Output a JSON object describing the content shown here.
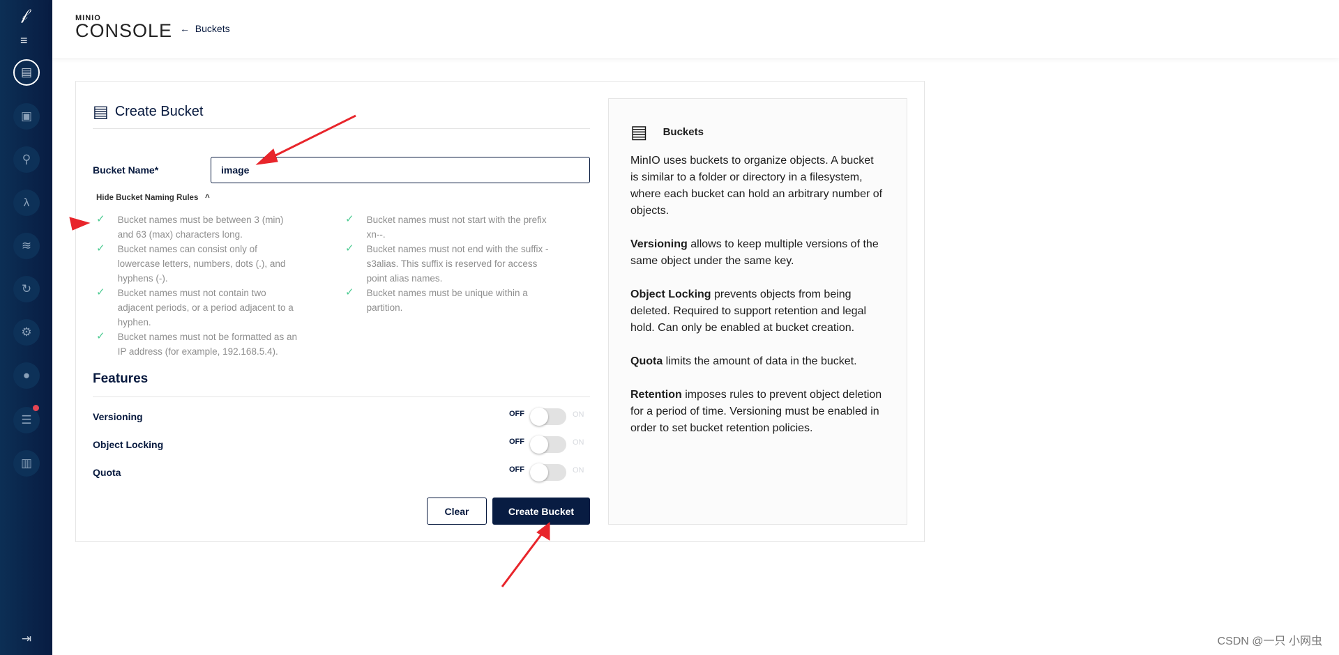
{
  "header": {
    "logo_top": "MINIO",
    "logo_bottom": "CONSOLE",
    "back_label": "Buckets"
  },
  "sidebar": {
    "icons": [
      "minio-bird-icon",
      "menu-icon",
      "buckets-icon",
      "identity-icon",
      "monitoring-icon",
      "lambda-icon",
      "tiers-icon",
      "replication-icon",
      "settings-icon",
      "health-icon",
      "license-icon",
      "documentation-icon",
      "logout-icon"
    ],
    "badge_color": "#e64553"
  },
  "form": {
    "title": "Create Bucket",
    "bucket_name_label": "Bucket Name*",
    "bucket_name_value": "image",
    "rules_toggle": "Hide Bucket Naming Rules",
    "rules_left": [
      "Bucket names must be between 3 (min) and 63 (max) characters long.",
      "Bucket names can consist only of lowercase letters, numbers, dots (.), and hyphens (-).",
      "Bucket names must not contain two adjacent periods, or a period adjacent to a hyphen.",
      "Bucket names must not be formatted as an IP address (for example, 192.168.5.4)."
    ],
    "rules_right": [
      "Bucket names must not start with the prefix xn--.",
      "Bucket names must not end with the suffix -s3alias. This suffix is reserved for access point alias names.",
      "Bucket names must be unique within a partition."
    ],
    "features_title": "Features",
    "features": [
      {
        "label": "Versioning",
        "off": "OFF",
        "on": "ON",
        "enabled": false
      },
      {
        "label": "Object Locking",
        "off": "OFF",
        "on": "ON",
        "enabled": false
      },
      {
        "label": "Quota",
        "off": "OFF",
        "on": "ON",
        "enabled": false
      }
    ],
    "clear_label": "Clear",
    "create_label": "Create Bucket"
  },
  "info": {
    "title": "Buckets",
    "paragraphs": [
      {
        "bold": "",
        "text": "MinIO uses buckets to organize objects. A bucket is similar to a folder or directory in a filesystem, where each bucket can hold an arbitrary number of objects."
      },
      {
        "bold": "Versioning",
        "text": " allows to keep multiple versions of the same object under the same key."
      },
      {
        "bold": "Object Locking",
        "text": " prevents objects from being deleted. Required to support retention and legal hold. Can only be enabled at bucket creation."
      },
      {
        "bold": "Quota",
        "text": " limits the amount of data in the bucket."
      },
      {
        "bold": "Retention",
        "text": " imposes rules to prevent object deletion for a period of time. Versioning must be enabled in order to set bucket retention policies."
      }
    ]
  },
  "watermark": "CSDN @一只 小网虫",
  "colors": {
    "primary": "#081c42",
    "check": "#4ccb92",
    "annotation": "#e8252b"
  }
}
